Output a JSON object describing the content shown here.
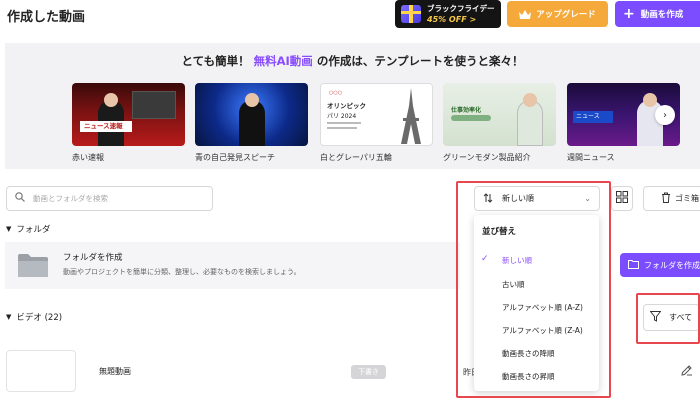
{
  "header": {
    "title": "作成した動画",
    "black_friday_line1": "ブラックフライデー",
    "black_friday_line2": "45% OFF >",
    "upgrade_label": "アップグレード",
    "create_video_label": "動画を作成"
  },
  "banner": {
    "headline_prefix": "とても簡単！",
    "headline_highlight": "無料AI動画",
    "headline_suffix": "の作成は、テンプレートを使うと楽々！",
    "templates": [
      {
        "label": "赤い速報",
        "overlay_text": "ニュース速報"
      },
      {
        "label": "青の自己発見スピーチ"
      },
      {
        "label": "白とグレーパリ五輪",
        "overlay_text": "オリンピック",
        "overlay_text2": "パリ 2024"
      },
      {
        "label": "グリーンモダン製品紹介",
        "overlay_text": "仕事効率化"
      },
      {
        "label": "週間ニュース",
        "overlay_text": "ニュース"
      }
    ]
  },
  "search": {
    "placeholder": "動画とフォルダを検索"
  },
  "sort": {
    "current": "新しい順"
  },
  "trash": {
    "label": "ゴミ箱"
  },
  "folders": {
    "section_label": "フォルダ",
    "card_title": "フォルダを作成",
    "card_desc": "動画やプロジェクトを簡単に分類、整理し、必要なものを検索しましょう。",
    "create_label": "フォルダを作成"
  },
  "videos": {
    "section_label": "ビデオ (22)",
    "filter_label": "すべて",
    "items": [
      {
        "title": "無題動画",
        "status": "下書き",
        "partial": "昨日"
      }
    ]
  },
  "dropdown": {
    "header": "並び替え",
    "items": [
      {
        "label": "新しい順",
        "selected": true
      },
      {
        "label": "古い順"
      },
      {
        "label": "アルファベット順 (A-Z)"
      },
      {
        "label": "アルファベット順 (Z-A)"
      },
      {
        "label": "動画長さの降順"
      },
      {
        "label": "動画長さの昇順"
      }
    ]
  },
  "colors": {
    "accent": "#7b4dff",
    "upgrade": "#f4a93a",
    "highlight_box": "#e8474e"
  }
}
